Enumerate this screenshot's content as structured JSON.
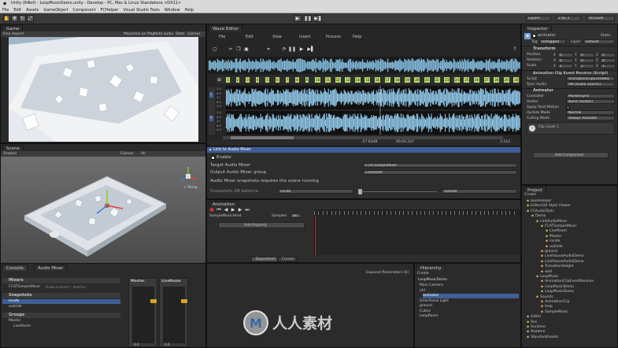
{
  "window": {
    "title": "Unity (64bit) - LoopMusicDemo.unity - Develop - PC, Mac & Linux Standalone <DX11>"
  },
  "menubar": [
    "File",
    "Edit",
    "Assets",
    "GameObject",
    "Component",
    "FCHelper",
    "Visual Studio Tools",
    "Window",
    "Help"
  ],
  "toolbar": {
    "layers": "Layers",
    "layout": "Layout",
    "layers2": "2 by 3",
    "account": "Account"
  },
  "game": {
    "tab": "Game",
    "display": "Free Aspect",
    "options": [
      "Maximize on Play",
      "Mute audio",
      "Stats",
      "Gizmos"
    ]
  },
  "scene": {
    "tab": "Scene",
    "shaded": "Shaded",
    "gizmos": "Gizmos",
    "search": "All",
    "persp": "< Persp"
  },
  "wave": {
    "tab": "Wave Editor",
    "menu": [
      "File",
      "Edit",
      "View",
      "Insert",
      "Process",
      "Help"
    ],
    "markers": [
      "1",
      "2",
      "3",
      "4",
      "5",
      "6",
      "7",
      "8",
      "9",
      "10",
      "11",
      "12",
      "13",
      "14",
      "15",
      "16",
      "17",
      "18",
      "19",
      "20",
      "21",
      "22",
      "23",
      "24",
      "25",
      "26",
      "27",
      "28",
      "29",
      "30"
    ],
    "channels": [
      "L",
      "R"
    ],
    "db_left": [
      "-2.0",
      "-6.0",
      "-12",
      "-6.0",
      "-2.0"
    ],
    "db_right": [
      "-2.0",
      "-6.0",
      "-12",
      "-6.0",
      "-2.0"
    ],
    "status": {
      "level": "-27.63dB",
      "time": "00:04.247",
      "zoom": "1:512"
    }
  },
  "link": {
    "header": "Link to Audio Mixer",
    "enable": "Enable",
    "target_label": "Target Audio Mixer",
    "target_value": "FCATSampleMixer",
    "group_label": "Output Audio Mixer group",
    "group_value": "LiveRoom",
    "note": "Audio Mixer snapshots requires the scene running",
    "balance_label": "Snapshots AB balance",
    "left": "inside",
    "right": "outside"
  },
  "animation": {
    "tab": "Animation",
    "clip": "SampleMusicHeat",
    "samples_label": "Samples",
    "samples": "60",
    "add_property": "Add Property",
    "dopesheet": "Dopesheet",
    "curves": "Curves"
  },
  "console": {
    "tabs": [
      "Console",
      "Audio Mixer"
    ]
  },
  "mixer": {
    "mixers_label": "Mixers",
    "mixer_item": "FCATSampleMixer",
    "mixer_sub": "(Audio Listener) - Inactive",
    "snapshots_label": "Snapshots",
    "snapshots": [
      "inside",
      "outside"
    ],
    "groups_label": "Groups",
    "groups": [
      "Master",
      "LiveRoom"
    ],
    "strips": [
      {
        "name": "Master",
        "db": "0.0"
      },
      {
        "name": "LiveRoom",
        "db": "0.0"
      }
    ],
    "exposed": "Exposed Parameters (0)"
  },
  "hierarchy": {
    "tab": "Hierarchy",
    "create": "Create",
    "scene": "LoopMusicDemo",
    "items": [
      "Main Camera",
      "ctrl",
      "animator",
      "Directional Light",
      "ground",
      "Cubes",
      "LoopRoom"
    ]
  },
  "inspector": {
    "tab": "Inspector",
    "name": "animator",
    "static": "Static",
    "tag_label": "Tag",
    "tag": "Untagged",
    "layer_label": "Layer",
    "layer": "Default",
    "transform": "Transform",
    "rows": [
      {
        "label": "Position",
        "x": "0",
        "y": "0",
        "z": "0"
      },
      {
        "label": "Rotation",
        "x": "0",
        "y": "0",
        "z": "0"
      },
      {
        "label": "Scale",
        "x": "1",
        "y": "1",
        "z": "1"
      }
    ],
    "comp1": "Animation Clip Event Receive (Script)",
    "script_label": "Script",
    "script": "AnimationClipEventRec",
    "sync_label": "Sync Audio",
    "sync": "AN (Audio Source)",
    "comp2": "Animator",
    "ctrl_label": "Controller",
    "ctrl": "MarkerSync",
    "avatar_label": "Avatar",
    "avatar": "None (Avatar)",
    "root_label": "Apply Root Motion",
    "update_label": "Update Mode",
    "update": "Normal",
    "cull_label": "Culling Mode",
    "cull": "Always Animate",
    "clip_info": "Clip Count: 1",
    "add_component": "Add Component"
  },
  "project": {
    "tab": "Project",
    "create": "Create",
    "items": [
      "BuildHelper",
      "EditorGUI Style Viewer",
      "FCAudioTools",
      "Demo",
      "LinkAudioMixer",
      "FCATSampleMixer",
      "LiveRoom",
      "Master",
      "inside",
      "outside",
      "ground",
      "LiveHouseAudioDemo",
      "LiveHouseAudioDemo",
      "TransitionHeight",
      "wall",
      "LoopMusic",
      "AnimationClipEventReceive",
      "LoopMusicDemo",
      "LoopMusicDemo",
      "Sounds",
      "AnimationClip",
      "loop",
      "SampleMusic",
      "Editor",
      "Res",
      "Runtime",
      "Readme",
      "StandardAssets"
    ]
  },
  "watermark": "人人素材"
}
